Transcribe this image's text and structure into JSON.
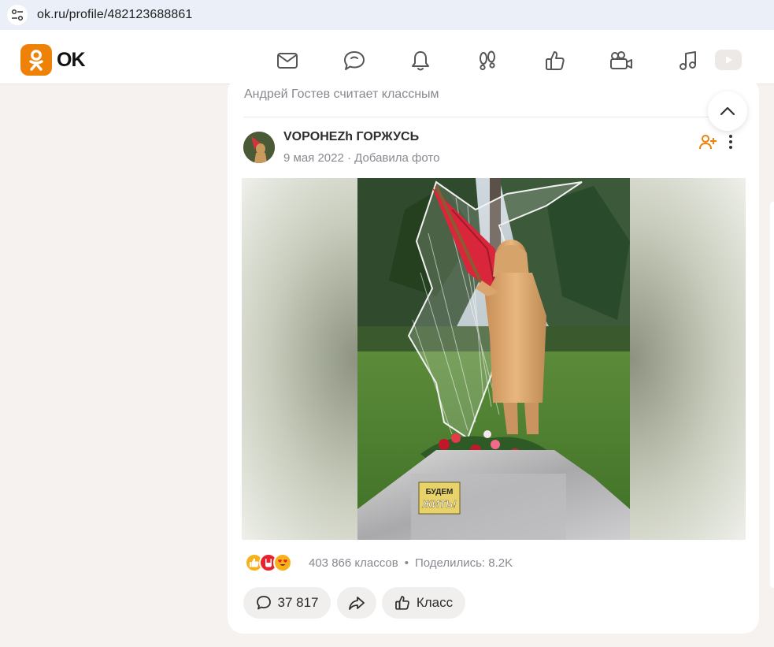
{
  "browser": {
    "url": "ok.ru/profile/482123688861"
  },
  "header": {
    "logo_text": "OK",
    "nav_icons": [
      "mail-icon",
      "chat-icon",
      "bell-icon",
      "footprints-icon",
      "like-icon",
      "video-camera-icon",
      "music-icon",
      "play-icon"
    ]
  },
  "post": {
    "liked_by": "Андрей Гостев считает классным",
    "group_name": "VOPOHEZh ГОРЖУСЬ",
    "date": "9 мая 2022",
    "meta_sep": " · ",
    "action": "Добавила фото",
    "photo_sign_line1": "БУДЕМ",
    "photo_sign_line2": "ЖИТЬ!",
    "reactions": [
      "like",
      "rock",
      "heart-eyes"
    ],
    "classes_count": "403 866 классов",
    "stats_dot": "•",
    "shared": "Поделились: 8.2K",
    "comments_count": "37 817",
    "class_label": "Класс"
  },
  "colors": {
    "brand": "#ee8208",
    "text": "#2c2d2e",
    "muted": "#87898f",
    "page_bg": "#f5f2ef"
  }
}
